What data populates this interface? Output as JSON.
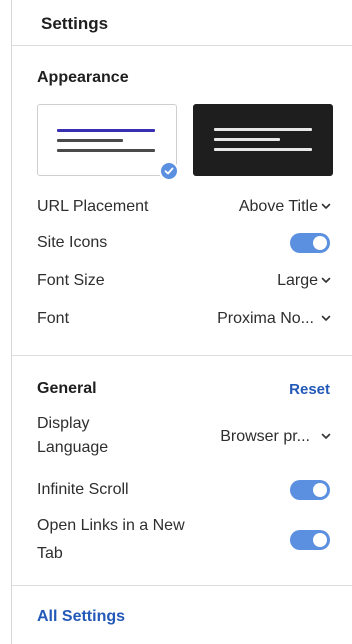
{
  "header": {
    "title": "Settings"
  },
  "appearance": {
    "title": "Appearance",
    "themes": [
      {
        "name": "light-theme",
        "selected": true
      },
      {
        "name": "dark-theme",
        "selected": false
      }
    ],
    "rows": [
      {
        "label": "URL Placement",
        "value": "Above Title"
      },
      {
        "label": "Site Icons",
        "toggle": true
      },
      {
        "label": "Font Size",
        "value": "Large"
      },
      {
        "label": "Font",
        "value": "Proxima No..."
      }
    ]
  },
  "general": {
    "title": "General",
    "reset_label": "Reset",
    "display_language_label_line1": "Display",
    "display_language_label_line2": "Language",
    "display_language_value": "Browser pr...",
    "infinite_scroll_label": "Infinite Scroll",
    "infinite_scroll_on": true,
    "open_links_label_line1": "Open Links in a New",
    "open_links_label_line2": "Tab",
    "open_links_on": true
  },
  "footer": {
    "all_settings_label": "All Settings"
  },
  "colors": {
    "accent": "#5b8fe0",
    "link": "#2359b8",
    "theme_line_accent": "#3a2fb0",
    "dark_theme_bg": "#1e1e1e"
  }
}
